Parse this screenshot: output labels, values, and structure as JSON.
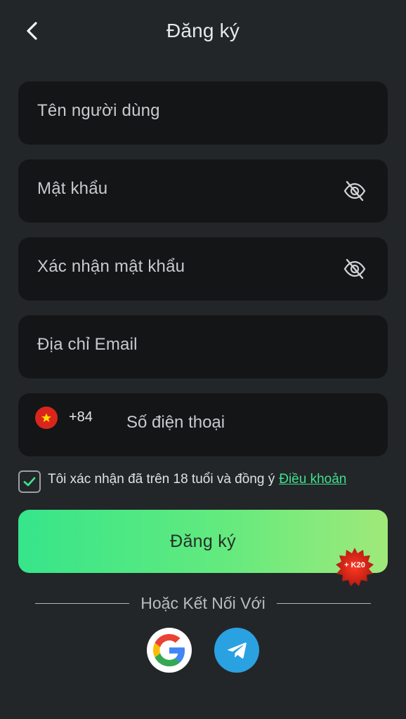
{
  "header": {
    "title": "Đăng ký",
    "back_icon": "chevron-left-icon"
  },
  "form": {
    "username": {
      "placeholder": "Tên người dùng"
    },
    "password": {
      "placeholder": "Mật khẩu",
      "toggle_icon": "eye-off-icon"
    },
    "confirm_password": {
      "placeholder": "Xác nhận mật khẩu",
      "toggle_icon": "eye-off-icon"
    },
    "email": {
      "placeholder": "Địa chỉ Email"
    },
    "phone": {
      "country_flag_icon": "vietnam-flag-icon",
      "country_code": "+84",
      "placeholder": "Số điện thoại"
    }
  },
  "consent": {
    "checked": true,
    "text": "Tôi xác nhận đã trên 18 tuổi và đồng ý",
    "link_label": "Điều khoản"
  },
  "submit": {
    "label": "Đăng ký",
    "bonus_badge": "+ K20"
  },
  "social": {
    "divider_text": "Hoặc Kết Nối Với",
    "providers": [
      {
        "name": "google",
        "icon": "google-icon"
      },
      {
        "name": "telegram",
        "icon": "telegram-icon"
      }
    ]
  },
  "colors": {
    "background": "#232628",
    "field_bg": "#141516",
    "accent_green": "#3fe08f",
    "button_gradient_start": "#36e58a",
    "button_gradient_end": "#a0e97a",
    "badge_red": "#d7261b",
    "telegram_blue": "#2aa1e1"
  }
}
